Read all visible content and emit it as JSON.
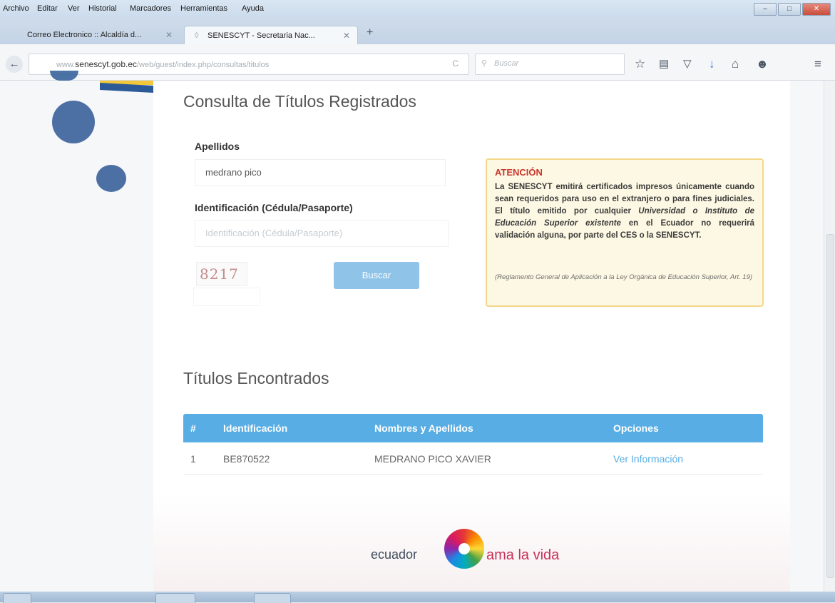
{
  "menu": [
    "Archivo",
    "Editar",
    "Ver",
    "Historial",
    "Marcadores",
    "Herramientas",
    "Ayuda"
  ],
  "tabs": [
    {
      "label": "Correo Electronico :: Alcaldía d...",
      "active": false
    },
    {
      "label": "SENESCYT - Secretaria Nac...",
      "active": true
    }
  ],
  "url": {
    "prefix": "www.",
    "host": "senescyt.gob.ec",
    "path": "/web/guest/index.php/consultas/titulos"
  },
  "search": {
    "placeholder": "Buscar"
  },
  "toolbar_icons": [
    "star-icon",
    "reading-list-icon",
    "pocket-icon",
    "download-icon",
    "home-icon",
    "chat-icon",
    "menu-icon"
  ],
  "page": {
    "title": "Consulta de Títulos Registrados",
    "form": {
      "surname_label": "Apellidos",
      "surname_value": "medrano pico",
      "id_label": "Identificación (Cédula/Pasaporte)",
      "id_placeholder": "Identificación (Cédula/Pasaporte)",
      "captcha_text": "8217",
      "search_button": "Buscar"
    },
    "alert": {
      "title": "ATENCIÓN",
      "body_1": "La SENESCYT emitirá certificados impresos únicamente cuando sean requeridos para uso en el extranjero o para fines judiciales. El título emitido por cualquier ",
      "body_italic": "Universidad o Instituto de Educación Superior existente",
      "body_2": " en el Ecuador no requerirá validación alguna, por parte del CES o la SENESCYT.",
      "reference": "(Reglamento General de Aplicación a la Ley Orgánica de Educación Superior, Art. 19)"
    },
    "results": {
      "title": "Títulos Encontrados",
      "columns": [
        "#",
        "Identificación",
        "Nombres y Apellidos",
        "Opciones"
      ],
      "rows": [
        {
          "num": "1",
          "id": "BE870522",
          "name": "MEDRANO PICO XAVIER",
          "action": "Ver Información"
        }
      ]
    },
    "footer": {
      "left": "ecuador",
      "right": "ama la vida"
    }
  },
  "colors": {
    "table_header": "#58aee4",
    "alert_title": "#c8372c",
    "button": "#8fc3e8"
  }
}
